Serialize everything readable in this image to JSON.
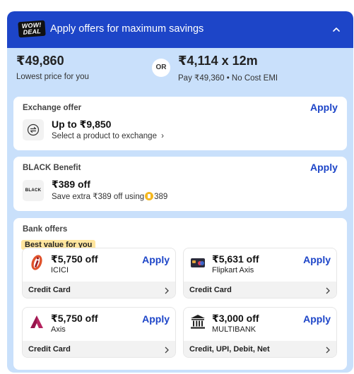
{
  "header": {
    "logo_text_line1": "WOW!",
    "logo_text_line2": "DEAL",
    "title": "Apply offers for maximum savings",
    "collapse_icon": "chevron-up-icon"
  },
  "pricing": {
    "lowest_price": "₹49,860",
    "lowest_label": "Lowest price for you",
    "or_label": "OR",
    "emi_price": "₹4,114 x 12m",
    "emi_label": "Pay ₹49,360 • No Cost EMI"
  },
  "exchange": {
    "title": "Exchange offer",
    "apply_label": "Apply",
    "icon": "exchange-icon",
    "amount": "Up to ₹9,850",
    "subtitle": "Select a product to exchange",
    "chevron": "›"
  },
  "black_benefit": {
    "title": "BLACK Benefit",
    "apply_label": "Apply",
    "logo_text": "BLACK",
    "amount": "₹389 off",
    "subtitle_prefix": "Save extra ₹389 off using",
    "coin_icon": "supercoin-icon",
    "coins": "389"
  },
  "bank_offers": {
    "title": "Bank offers",
    "best_tag": "Best value for you",
    "items": [
      {
        "amount": "₹5,750 off",
        "bank": "ICICI",
        "apply_label": "Apply",
        "payment": "Credit Card",
        "icon": "icici-logo-icon"
      },
      {
        "amount": "₹5,631 off",
        "bank": "Flipkart Axis",
        "apply_label": "Apply",
        "payment": "Credit Card",
        "icon": "flipkart-axis-card-icon"
      },
      {
        "amount": "₹5,750 off",
        "bank": "Axis",
        "apply_label": "Apply",
        "payment": "Credit Card",
        "icon": "axis-logo-icon"
      },
      {
        "amount": "₹3,000 off",
        "bank": "MULTIBANK",
        "apply_label": "Apply",
        "payment": "Credit, UPI, Debit, Net",
        "icon": "bank-building-icon"
      }
    ]
  },
  "colors": {
    "brand_blue": "#1d45c8",
    "panel_bg": "#c9e0fb",
    "best_tag_bg": "#ffe59e",
    "coin": "#f5b820"
  }
}
